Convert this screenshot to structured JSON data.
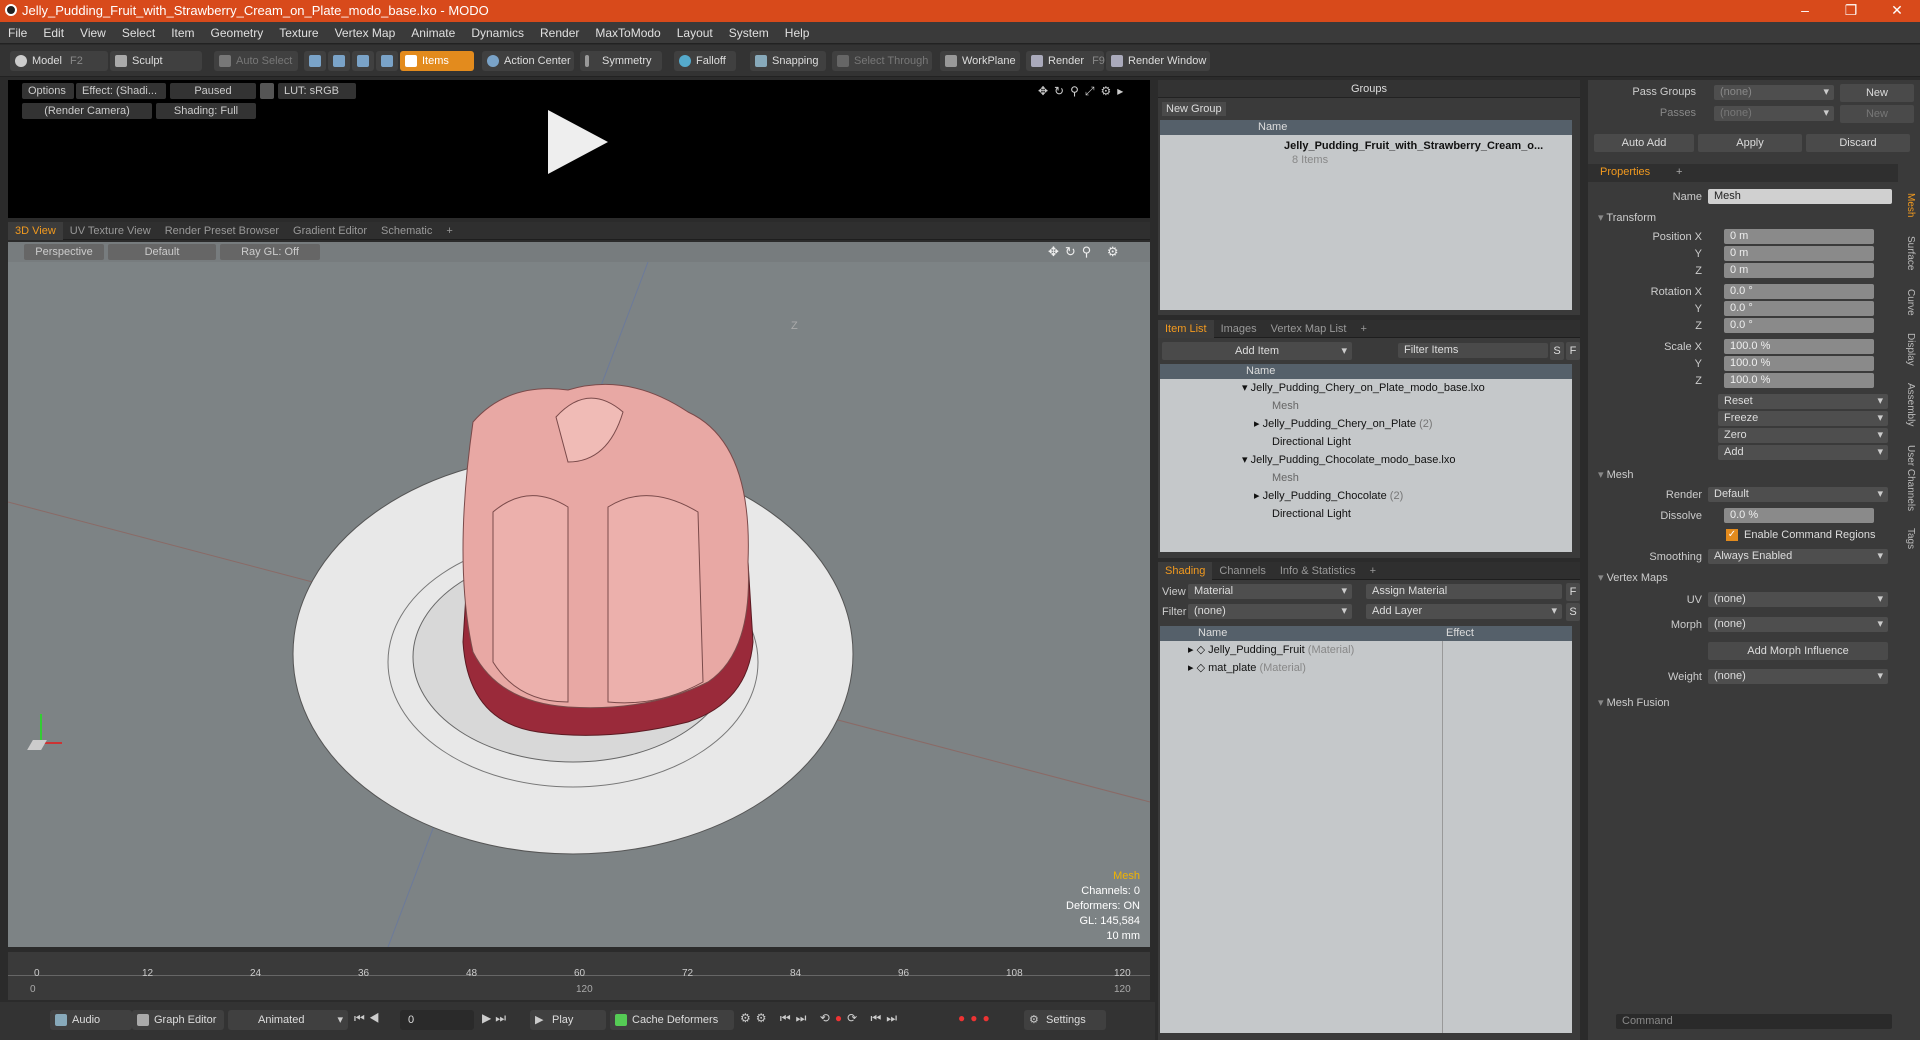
{
  "window": {
    "title": "Jelly_Pudding_Fruit_with_Strawberry_Cream_on_Plate_modo_base.lxo - MODO",
    "min": "–",
    "max": "❐",
    "close": "✕"
  },
  "menu": [
    "File",
    "Edit",
    "View",
    "Select",
    "Item",
    "Geometry",
    "Texture",
    "Vertex Map",
    "Animate",
    "Dynamics",
    "Render",
    "MaxToModo",
    "Layout",
    "System",
    "Help"
  ],
  "toolbar": {
    "model": "Model",
    "model_key": "F2",
    "sculpt": "Sculpt",
    "auto_select": "Auto Select",
    "items": "Items",
    "action_center": "Action Center",
    "symmetry": "Symmetry",
    "falloff": "Falloff",
    "snapping": "Snapping",
    "select_through": "Select Through",
    "workplane": "WorkPlane",
    "render": "Render",
    "render_key": "F9",
    "render_window": "Render Window"
  },
  "preview": {
    "options": "Options",
    "effect": "Effect: (Shadi...",
    "paused": "Paused",
    "lut": "LUT: sRGB",
    "camera": "(Render Camera)",
    "shading": "Shading: Full"
  },
  "view_tabs": [
    "3D View",
    "UV Texture View",
    "Render Preset Browser",
    "Gradient Editor",
    "Schematic",
    "+"
  ],
  "viewport": {
    "perspective": "Perspective",
    "default": "Default",
    "raygl": "Ray GL: Off",
    "axis_z": "Z",
    "stats": {
      "type": "Mesh",
      "channels": "Channels: 0",
      "deformers": "Deformers: ON",
      "gl": "GL: 145,584",
      "unit": "10 mm"
    }
  },
  "timeline": {
    "ticks": [
      "0",
      "12",
      "24",
      "36",
      "48",
      "60",
      "72",
      "84",
      "96",
      "108",
      "120"
    ],
    "start": "0",
    "end_mid": "120",
    "end": "120"
  },
  "transport": {
    "audio": "Audio",
    "graph_editor": "Graph Editor",
    "animated": "Animated",
    "frame": "0",
    "play": "Play",
    "cache": "Cache Deformers",
    "settings": "Settings"
  },
  "groups": {
    "title": "Groups",
    "new_group": "New Group",
    "col_name": "Name",
    "item": "Jelly_Pudding_Fruit_with_Strawberry_Cream_o...",
    "count": "8 Items"
  },
  "itemlist": {
    "tabs": [
      "Item List",
      "Images",
      "Vertex Map List",
      "+"
    ],
    "add_item": "Add Item",
    "filter": "Filter Items",
    "s": "S",
    "f": "F",
    "col_name": "Name",
    "rows": [
      {
        "label": "Jelly_Pudding_Chery_on_Plate_modo_base.lxo",
        "extra": ""
      },
      {
        "label": "Mesh",
        "extra": ""
      },
      {
        "label": "Jelly_Pudding_Chery_on_Plate",
        "extra": "(2)"
      },
      {
        "label": "Directional Light",
        "extra": ""
      },
      {
        "label": "Jelly_Pudding_Chocolate_modo_base.lxo",
        "extra": ""
      },
      {
        "label": "Mesh",
        "extra": ""
      },
      {
        "label": "Jelly_Pudding_Chocolate",
        "extra": "(2)"
      },
      {
        "label": "Directional Light",
        "extra": ""
      }
    ]
  },
  "shading": {
    "tabs": [
      "Shading",
      "Channels",
      "Info & Statistics",
      "+"
    ],
    "view_label": "View",
    "view_value": "Material",
    "assign": "Assign Material",
    "filter_label": "Filter",
    "filter_value": "(none)",
    "add_layer": "Add Layer",
    "f": "F",
    "s": "S",
    "col_name": "Name",
    "col_effect": "Effect",
    "rows": [
      {
        "label": "Jelly_Pudding_Fruit",
        "extra": "(Material)"
      },
      {
        "label": "mat_plate",
        "extra": "(Material)"
      }
    ]
  },
  "passes": {
    "groups_label": "Pass Groups",
    "groups_value": "(none)",
    "new": "New",
    "passes_label": "Passes",
    "passes_value": "(none)",
    "new2": "New"
  },
  "actions": {
    "auto_add": "Auto Add",
    "apply": "Apply",
    "discard": "Discard"
  },
  "properties": {
    "tab": "Properties",
    "plus": "+",
    "name_label": "Name",
    "name_value": "Mesh",
    "transform": "Transform",
    "pos_label": "Position X",
    "pos": [
      "0 m",
      "0 m",
      "0 m"
    ],
    "rot_label": "Rotation X",
    "rot": [
      "0.0 °",
      "0.0 °",
      "0.0 °"
    ],
    "scale_label": "Scale X",
    "scale": [
      "100.0 %",
      "100.0 %",
      "100.0 %"
    ],
    "y": "Y",
    "z": "Z",
    "reset": "Reset",
    "freeze": "Freeze",
    "zero": "Zero",
    "add": "Add",
    "mesh": "Mesh",
    "render_label": "Render",
    "render_value": "Default",
    "dissolve_label": "Dissolve",
    "dissolve_value": "0.0 %",
    "cmd_regions": "Enable Command Regions",
    "smoothing_label": "Smoothing",
    "smoothing_value": "Always Enabled",
    "vertex_maps": "Vertex Maps",
    "uv_label": "UV",
    "uv_value": "(none)",
    "morph_label": "Morph",
    "morph_value": "(none)",
    "add_morph": "Add Morph Influence",
    "weight_label": "Weight",
    "weight_value": "(none)",
    "mesh_fusion": "Mesh Fusion"
  },
  "side_tabs": [
    "Mesh",
    "Surface",
    "Curve",
    "Display",
    "Assembly",
    "User Channels",
    "Tags"
  ],
  "command": {
    "placeholder": "Command"
  }
}
